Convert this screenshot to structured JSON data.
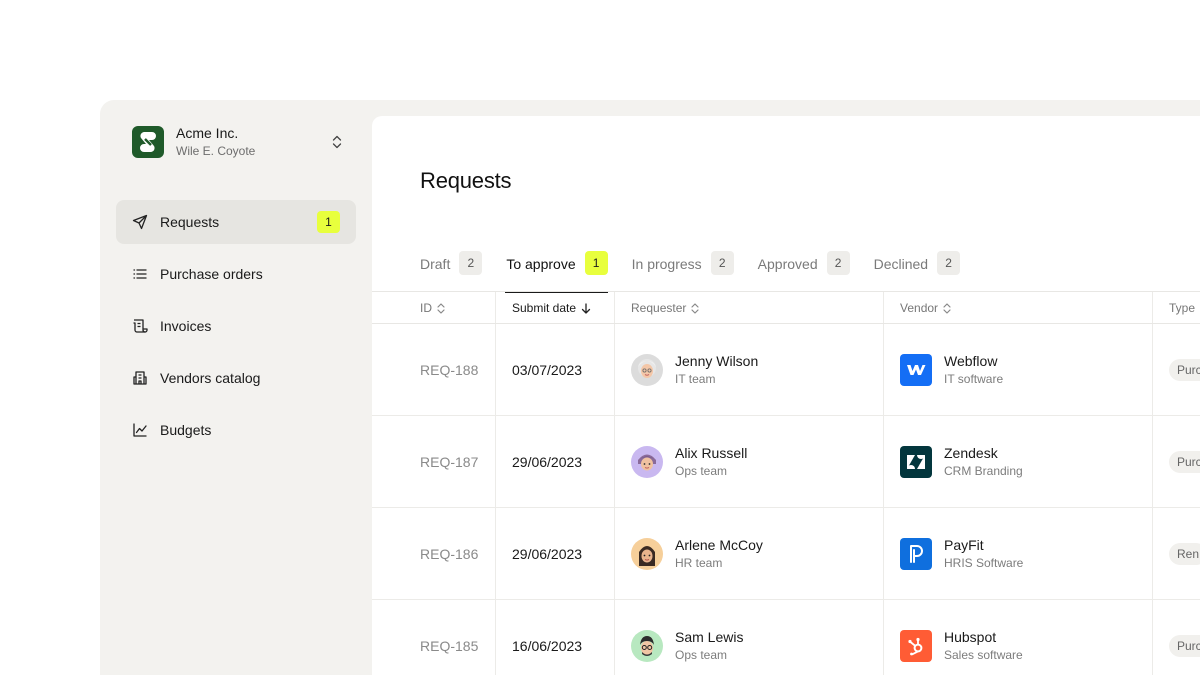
{
  "org": {
    "name": "Acme Inc.",
    "user": "Wile E. Coyote",
    "logo_icon": "acme-logo",
    "toggle_icon": "chevron-up-down-icon"
  },
  "nav": {
    "items": [
      {
        "label": "Requests",
        "icon": "send-icon",
        "badge": "1",
        "active": true
      },
      {
        "label": "Purchase orders",
        "icon": "list-icon"
      },
      {
        "label": "Invoices",
        "icon": "scroll-icon"
      },
      {
        "label": "Vendors catalog",
        "icon": "building-icon"
      },
      {
        "label": "Budgets",
        "icon": "chart-line-icon"
      }
    ]
  },
  "page": {
    "title": "Requests"
  },
  "tabs": [
    {
      "label": "Draft",
      "count": "2"
    },
    {
      "label": "To approve",
      "count": "1",
      "active": true
    },
    {
      "label": "In progress",
      "count": "2"
    },
    {
      "label": "Approved",
      "count": "2"
    },
    {
      "label": "Declined",
      "count": "2"
    }
  ],
  "table": {
    "headers": {
      "id": "ID",
      "submit_date": "Submit date",
      "requester": "Requester",
      "vendor": "Vendor",
      "type": "Type"
    },
    "rows": [
      {
        "id": "REQ-188",
        "date": "03/07/2023",
        "requester": "Jenny Wilson",
        "team": "IT team",
        "vendor": "Webflow",
        "vendor_category": "IT software",
        "type": "Purc"
      },
      {
        "id": "REQ-187",
        "date": "29/06/2023",
        "requester": "Alix Russell",
        "team": "Ops team",
        "vendor": "Zendesk",
        "vendor_category": "CRM Branding",
        "type": "Purc"
      },
      {
        "id": "REQ-186",
        "date": "29/06/2023",
        "requester": "Arlene McCoy",
        "team": "HR team",
        "vendor": "PayFit",
        "vendor_category": "HRIS Software",
        "type": "Ren"
      },
      {
        "id": "REQ-185",
        "date": "16/06/2023",
        "requester": "Sam Lewis",
        "team": "Ops team",
        "vendor": "Hubspot",
        "vendor_category": "Sales software",
        "type": "Purc"
      }
    ]
  },
  "colors": {
    "accent_badge": "#e8ff3d",
    "brand_green": "#1f5a2a",
    "webflow": "#146ef5",
    "zendesk": "#03363d",
    "payfit": "#0f6fde",
    "hubspot": "#ff5c35"
  }
}
